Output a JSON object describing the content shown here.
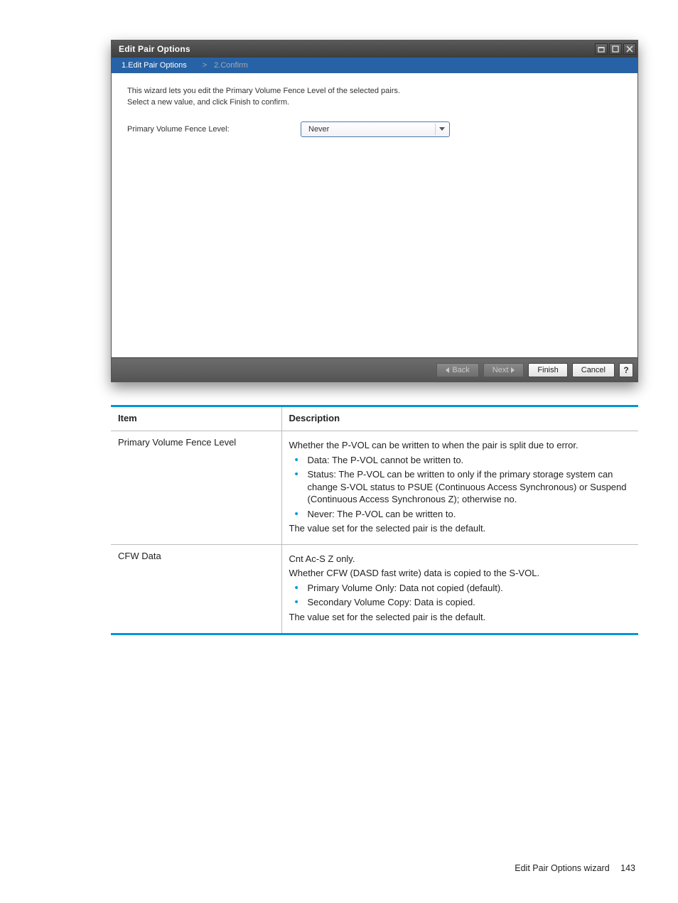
{
  "dialog": {
    "title": "Edit Pair Options",
    "steps": {
      "s1": "1.Edit Pair Options",
      "s2": "2.Confirm"
    },
    "intro_line1": "This wizard lets you edit the Primary Volume Fence Level of the selected pairs.",
    "intro_line2": "Select a new value, and click Finish to confirm.",
    "form": {
      "label": "Primary Volume Fence Level:",
      "value": "Never"
    },
    "buttons": {
      "back": "Back",
      "next": "Next",
      "finish": "Finish",
      "cancel": "Cancel",
      "help": "?"
    }
  },
  "table": {
    "headers": {
      "item": "Item",
      "desc": "Description"
    },
    "rows": [
      {
        "item": "Primary Volume Fence Level",
        "lead": "Whether the P-VOL can be written to when the pair is split due to error.",
        "bullets": [
          "Data: The P-VOL cannot be written to.",
          "Status: The P-VOL can be written to only if the primary storage system can change S-VOL status to PSUE (Continuous Access Synchronous) or Suspend (Continuous Access Synchronous Z); otherwise no.",
          "Never: The P-VOL can be written to."
        ],
        "trail": "The value set for the selected pair is the default."
      },
      {
        "item": "CFW Data",
        "lead2": "Cnt Ac-S Z only.",
        "lead": "Whether CFW (DASD fast write) data is copied to the S-VOL.",
        "bullets": [
          "Primary Volume Only: Data not copied (default).",
          "Secondary Volume Copy: Data is copied."
        ],
        "trail": "The value set for the selected pair is the default."
      }
    ]
  },
  "footer": {
    "text": "Edit Pair Options wizard",
    "page": "143"
  }
}
